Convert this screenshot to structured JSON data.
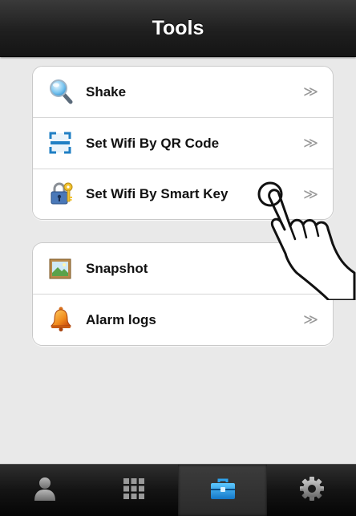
{
  "header": {
    "title": "Tools"
  },
  "groups": [
    {
      "items": [
        {
          "label": "Shake",
          "icon": "magnifier-icon",
          "chevron": "≫"
        },
        {
          "label": "Set Wifi By QR Code",
          "icon": "qr-scan-icon",
          "chevron": "≫"
        },
        {
          "label": "Set Wifi By Smart Key",
          "icon": "lock-key-icon",
          "chevron": "≫"
        }
      ]
    },
    {
      "items": [
        {
          "label": "Snapshot",
          "icon": "picture-icon",
          "chevron": "≫"
        },
        {
          "label": "Alarm logs",
          "icon": "bell-icon",
          "chevron": "≫"
        }
      ]
    }
  ],
  "tabbar": {
    "tabs": [
      {
        "icon": "person-icon",
        "active": false
      },
      {
        "icon": "grid-icon",
        "active": false
      },
      {
        "icon": "toolbox-icon",
        "active": true
      },
      {
        "icon": "gear-icon",
        "active": false
      }
    ]
  },
  "colors": {
    "accent": "#1e9be6",
    "navbar": "#1f1f1f",
    "background": "#e9e9e9"
  }
}
